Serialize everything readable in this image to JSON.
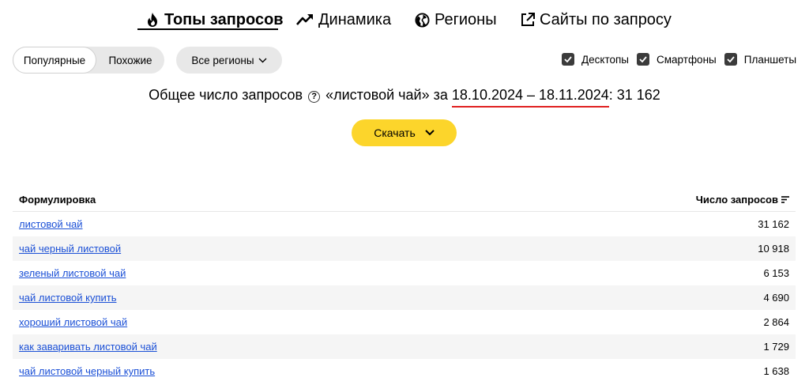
{
  "tabs": [
    {
      "label": "Топы запросов",
      "icon": "fire-icon",
      "active": true
    },
    {
      "label": "Динамика",
      "icon": "trend-up-icon",
      "active": false
    },
    {
      "label": "Регионы",
      "icon": "globe-icon",
      "active": false
    },
    {
      "label": "Сайты по запросу",
      "icon": "external-link-icon",
      "active": false
    }
  ],
  "mode_toggle": {
    "popular": "Популярные",
    "similar": "Похожие"
  },
  "region_select": {
    "label": "Все регионы"
  },
  "devices": [
    {
      "label": "Десктопы",
      "checked": true
    },
    {
      "label": "Смартфоны",
      "checked": true
    },
    {
      "label": "Планшеты",
      "checked": true
    }
  ],
  "summary": {
    "prefix": "Общее число запросов",
    "query": "«листовой чай» за",
    "period": "18.10.2024 – 18.11.2024",
    "total": ": 31 162"
  },
  "download": {
    "label": "Скачать"
  },
  "table": {
    "col_phrase": "Формулировка",
    "col_count": "Число запросов",
    "rows": [
      {
        "phrase": "листовой чай",
        "count": "31 162"
      },
      {
        "phrase": "чай черный листовой",
        "count": "10 918"
      },
      {
        "phrase": "зеленый листовой чай",
        "count": "6 153"
      },
      {
        "phrase": "чай листовой купить",
        "count": "4 690"
      },
      {
        "phrase": "хороший листовой чай",
        "count": "2 864"
      },
      {
        "phrase": "как заваривать листовой чай",
        "count": "1 729"
      },
      {
        "phrase": "чай листовой черный купить",
        "count": "1 638"
      }
    ]
  },
  "colors": {
    "accent_yellow": "#fcd52b",
    "link": "#1a4fd6",
    "period_underline": "#e02020"
  }
}
